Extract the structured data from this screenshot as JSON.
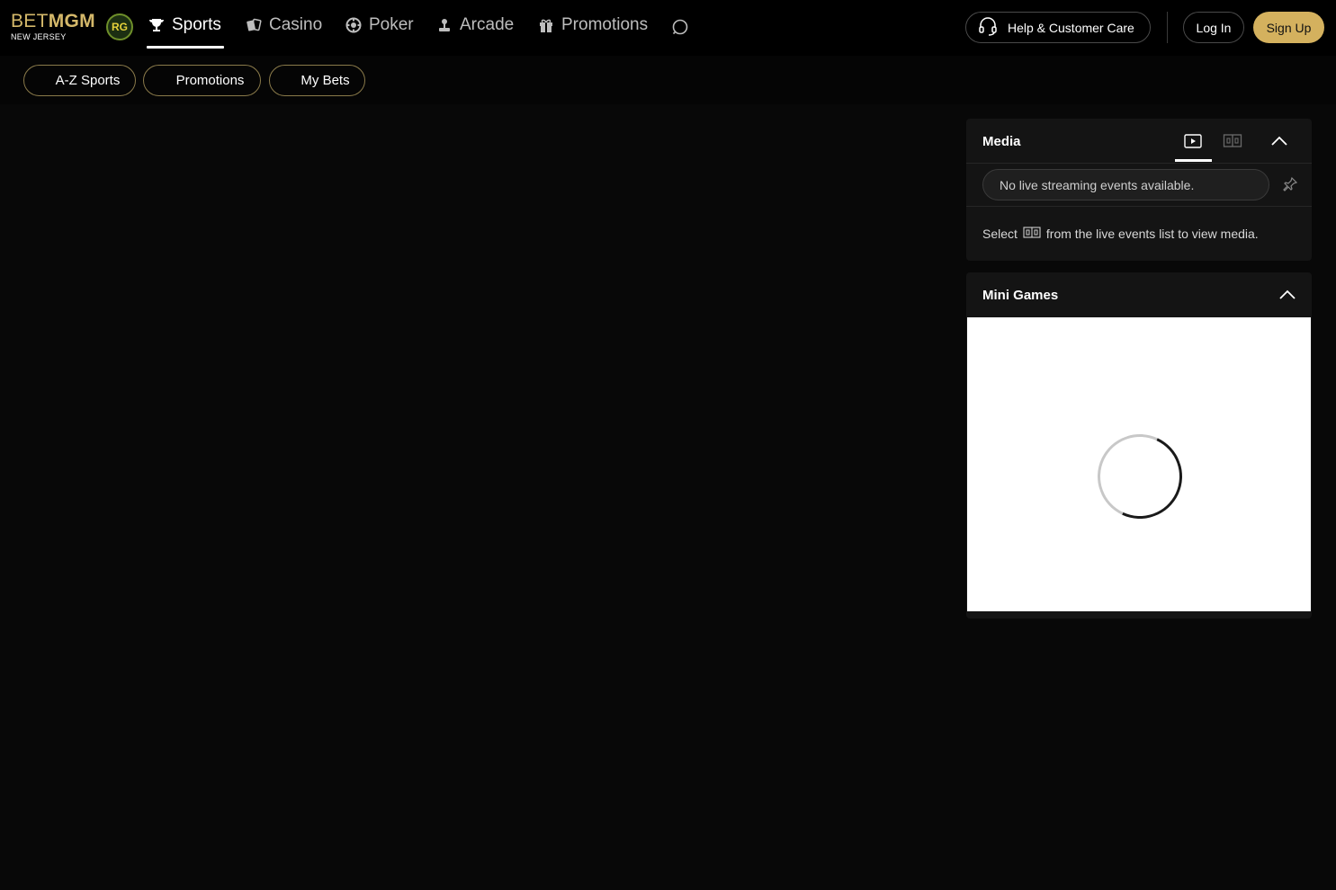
{
  "brand": {
    "logo_bet": "BET",
    "logo_mgm": "MGM",
    "region": "NEW JERSEY",
    "rg_badge": "RG",
    "accent_color": "#d4b15e"
  },
  "nav": {
    "items": [
      {
        "label": "Sports",
        "icon": "trophy-icon",
        "active": true
      },
      {
        "label": "Casino",
        "icon": "cards-icon",
        "active": false
      },
      {
        "label": "Poker",
        "icon": "poker-chip-icon",
        "active": false
      },
      {
        "label": "Arcade",
        "icon": "joystick-icon",
        "active": false
      },
      {
        "label": "Promotions",
        "icon": "gift-icon",
        "active": false
      }
    ],
    "search_icon": "search-icon"
  },
  "header_actions": {
    "help_label": "Help & Customer Care",
    "help_icon": "headset-icon",
    "login_label": "Log In",
    "signup_label": "Sign Up"
  },
  "subnav": {
    "pills": [
      {
        "label": "A-Z Sports"
      },
      {
        "label": "Promotions"
      },
      {
        "label": "My Bets"
      }
    ]
  },
  "media": {
    "title": "Media",
    "tabs": [
      {
        "icon": "video-play-icon",
        "active": true
      },
      {
        "icon": "scoreboard-icon",
        "active": false
      }
    ],
    "collapse_icon": "chevron-up-icon",
    "stream_placeholder": "No live streaming events available.",
    "pin_icon": "pin-icon",
    "select_prefix": "Select",
    "select_icon": "scoreboard-icon",
    "select_suffix": "from the live events list to view media."
  },
  "mini_games": {
    "title": "Mini Games",
    "collapse_icon": "chevron-up-icon",
    "loading_icon": "spinner-icon"
  }
}
